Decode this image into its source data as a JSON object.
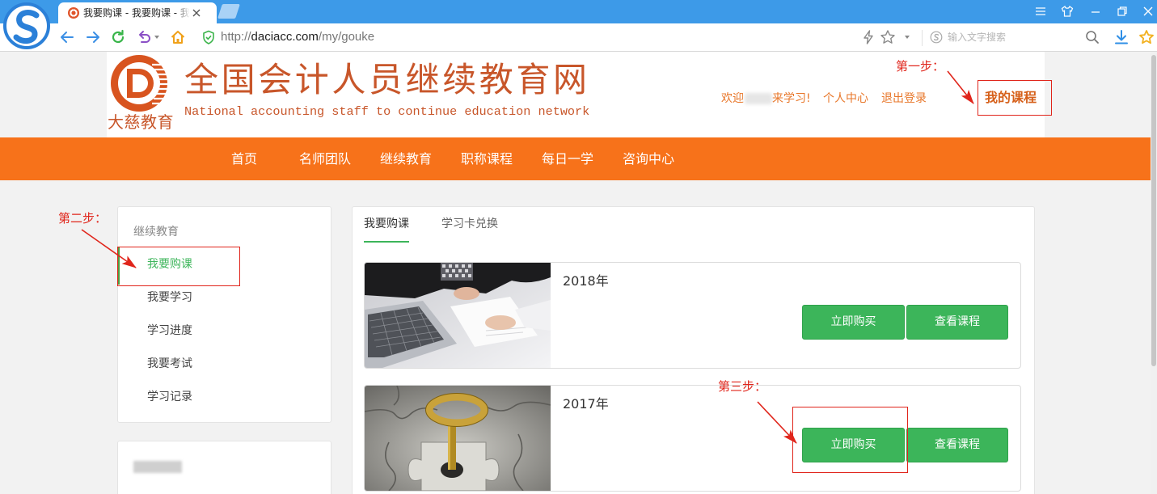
{
  "browser": {
    "tab": {
      "title": "我要购课 - 我要购课 - 我"
    },
    "address": {
      "scheme": "http://",
      "host": "daciacc.com",
      "path": "/my/gouke"
    },
    "search": {
      "placeholder": "输入文字搜索"
    },
    "toolbar_icons": [
      "back-icon",
      "forward-icon",
      "refresh-icon",
      "undo-icon",
      "home-icon",
      "secure-shield-icon",
      "speed-mode-icon",
      "bookmark-star-icon",
      "search-engine-icon",
      "search-icon",
      "download-icon",
      "favorites-star-icon"
    ],
    "window_icons": [
      "menu-icon",
      "skin-icon",
      "minimize-icon",
      "restore-icon",
      "close-icon"
    ]
  },
  "header": {
    "logo_text": "大慈教育",
    "title": "全国会计人员继续教育网",
    "subtitle": "National accounting staff to continue education network",
    "welcome_prefix": "欢迎",
    "welcome_suffix": "来学习!",
    "personal_center": "个人中心",
    "logout": "退出登录",
    "my_courses": "我的课程"
  },
  "nav": {
    "items": [
      "首页",
      "名师团队",
      "继续教育",
      "职称课程",
      "每日一学",
      "咨询中心"
    ]
  },
  "sidebar": {
    "section_title": "继续教育",
    "items": [
      {
        "label": "我要购课",
        "active": true
      },
      {
        "label": "我要学习",
        "active": false
      },
      {
        "label": "学习进度",
        "active": false
      },
      {
        "label": "我要考试",
        "active": false
      },
      {
        "label": "学习记录",
        "active": false
      }
    ]
  },
  "main": {
    "tabs": [
      {
        "label": "我要购课",
        "active": true
      },
      {
        "label": "学习卡兑换",
        "active": false
      }
    ],
    "courses": [
      {
        "title": "2018年",
        "buy_label": "立即购买",
        "view_label": "查看课程"
      },
      {
        "title": "2017年",
        "buy_label": "立即购买",
        "view_label": "查看课程"
      }
    ]
  },
  "annotations": {
    "step1": "第一步：",
    "step2": "第二步：",
    "step3": "第三步："
  },
  "colors": {
    "tabbar_blue": "#3d9ae8",
    "brand_orange": "#f7721a",
    "title_brown": "#c8562a",
    "link_orange": "#e8772a",
    "button_green": "#3cb55a",
    "annotation_red": "#e0251b"
  }
}
